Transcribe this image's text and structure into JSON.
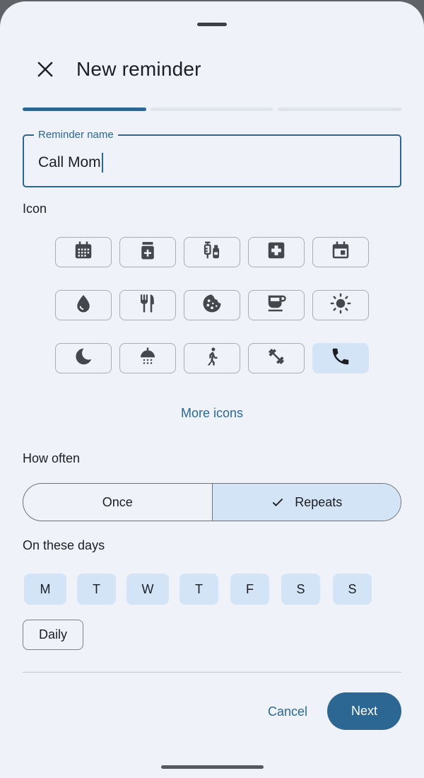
{
  "dialog": {
    "title": "New reminder",
    "progress": {
      "step": 1,
      "total_steps": 3
    }
  },
  "name_field": {
    "label": "Reminder name",
    "value": "Call Mom"
  },
  "icon_section": {
    "label": "Icon",
    "icons": [
      "calendar-month-icon",
      "medication-icon",
      "vaccines-icon",
      "medical-cross-icon",
      "event-icon",
      "water-drop-icon",
      "restaurant-icon",
      "cookie-icon",
      "coffee-icon",
      "sun-icon",
      "moon-icon",
      "shower-icon",
      "walking-icon",
      "fitness-icon",
      "phone-icon"
    ],
    "selected_icon": "phone-icon",
    "more_label": "More icons"
  },
  "frequency": {
    "label": "How often",
    "options": [
      "Once",
      "Repeats"
    ],
    "selected": "Repeats"
  },
  "days": {
    "label": "On these days",
    "items": [
      "M",
      "T",
      "W",
      "T",
      "F",
      "S",
      "S"
    ],
    "daily_label": "Daily"
  },
  "actions": {
    "cancel": "Cancel",
    "next": "Next"
  },
  "colors": {
    "accent": "#2c6793",
    "sheet_bg": "#eff2f9",
    "selected_bg": "#d3e4f6"
  }
}
